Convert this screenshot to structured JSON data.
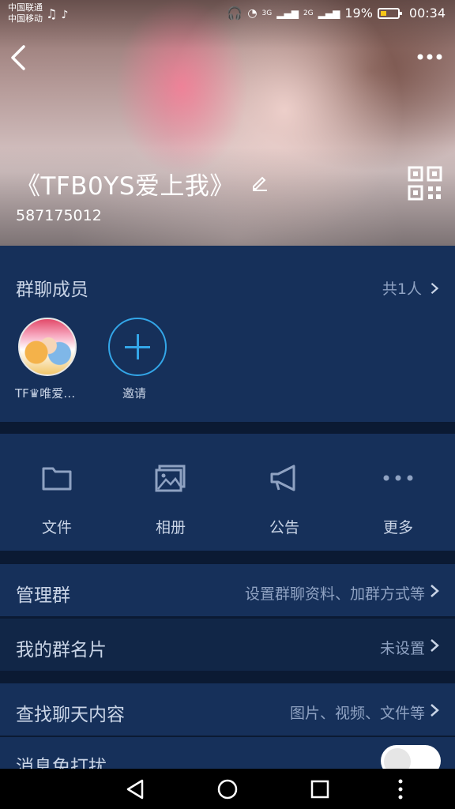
{
  "status_bar": {
    "carrier_1": "中国联通",
    "carrier_2": "中国移动",
    "battery_percent": "19%",
    "time": "00:34",
    "net_3g": "3G",
    "net_2g": "2G"
  },
  "header": {
    "title": "《TFB0YS爱上我》",
    "group_id": "587175012"
  },
  "members": {
    "label": "群聊成员",
    "count": "共1人",
    "member_name": "TF♛唯爱…",
    "invite_label": "邀请"
  },
  "tools": [
    {
      "label": "文件",
      "icon": "folder-icon"
    },
    {
      "label": "相册",
      "icon": "album-icon"
    },
    {
      "label": "公告",
      "icon": "announcement-icon"
    },
    {
      "label": "更多",
      "icon": "more-dots-icon"
    }
  ],
  "rows": {
    "manage": {
      "label": "管理群",
      "value": "设置群聊资料、加群方式等"
    },
    "card": {
      "label": "我的群名片",
      "value": "未设置"
    },
    "search": {
      "label": "查找聊天内容",
      "value": "图片、视频、文件等"
    },
    "dnd": {
      "label": "消息免打扰",
      "toggle_on": false
    }
  },
  "colors": {
    "background": "#0b1a33",
    "section": "#16305a",
    "accent": "#33a6e8"
  }
}
